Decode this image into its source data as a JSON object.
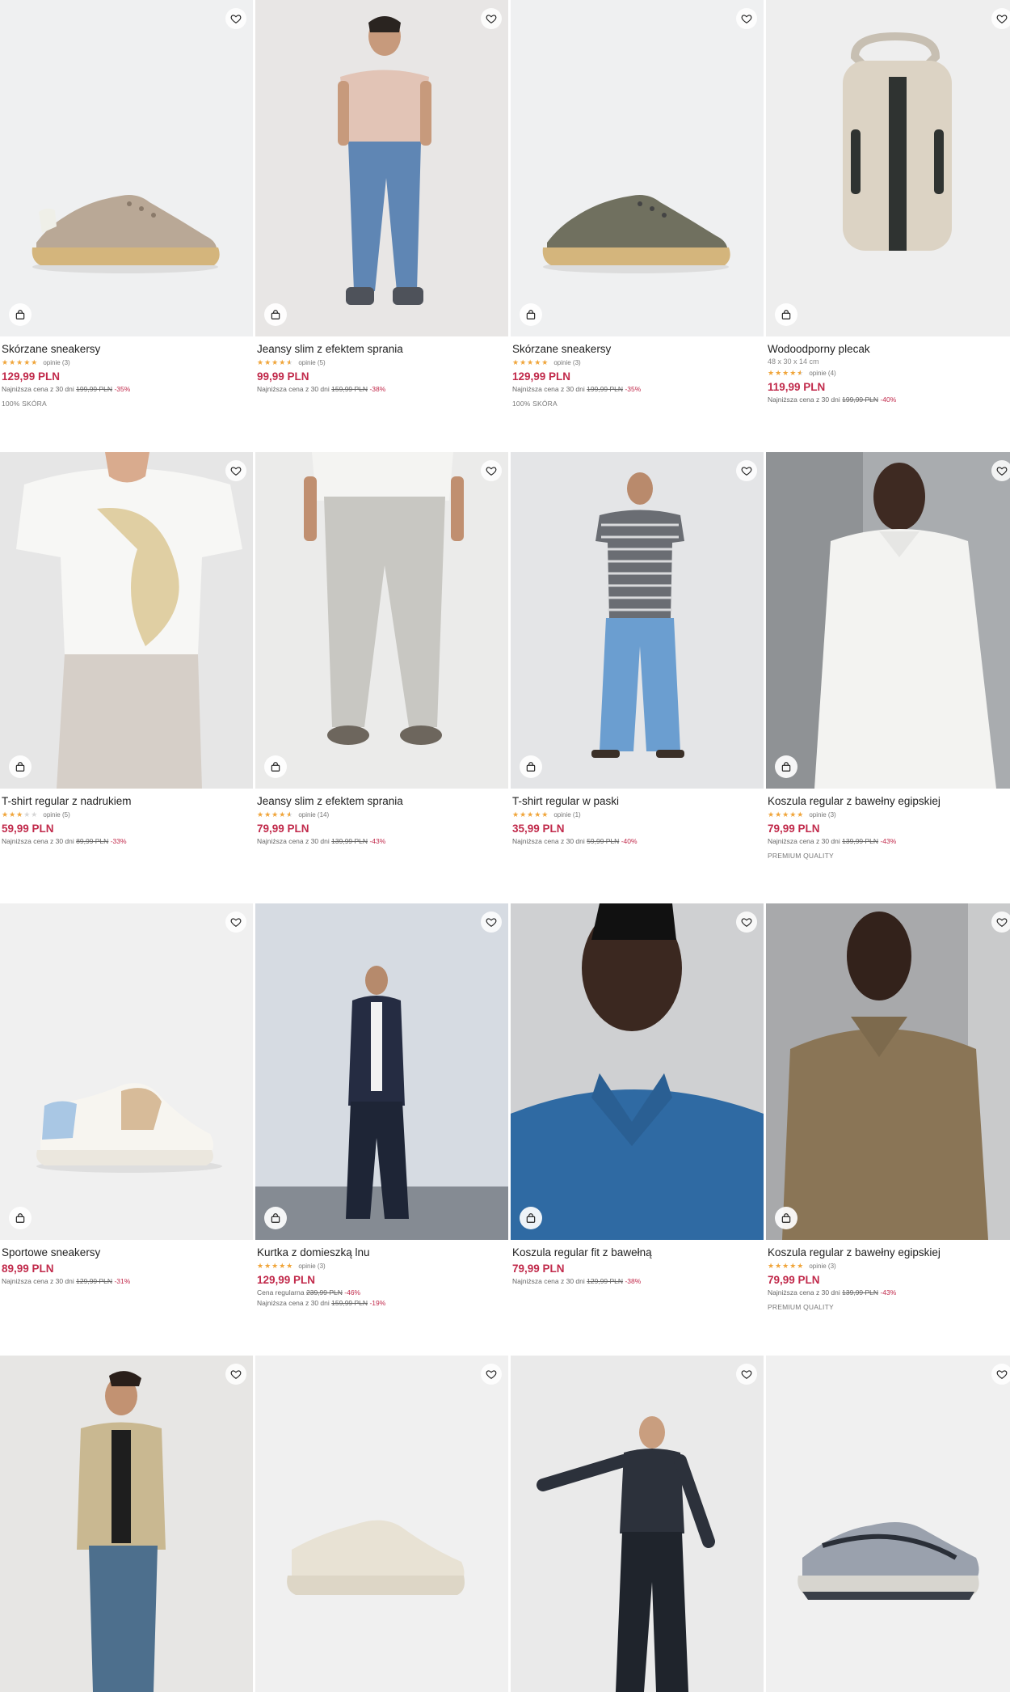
{
  "colors": {
    "price_red": "#c12a4b",
    "star": "#f0a53a"
  },
  "icons": {
    "favorite": "heart-icon",
    "add_to_bag": "shopping-bag-icon"
  },
  "products": [
    {
      "name": "Skórzane sneakersy",
      "reviews": "opinie (3)",
      "rating": 5,
      "price": "129,99 PLN",
      "lowest_label": "Najniższa cena z 30 dni",
      "lowest_old": "199,99 PLN",
      "lowest_pct": "-35%",
      "tag": "100% SKÓRA"
    },
    {
      "name": "Jeansy slim z efektem sprania",
      "reviews": "opinie (5)",
      "rating": 4.5,
      "price": "99,99 PLN",
      "lowest_label": "Najniższa cena z 30 dni",
      "lowest_old": "159,99 PLN",
      "lowest_pct": "-38%"
    },
    {
      "name": "Skórzane sneakersy",
      "reviews": "opinie (3)",
      "rating": 5,
      "price": "129,99 PLN",
      "lowest_label": "Najniższa cena z 30 dni",
      "lowest_old": "199,99 PLN",
      "lowest_pct": "-35%",
      "tag": "100% SKÓRA"
    },
    {
      "name": "Wodoodporny plecak",
      "subtitle": "48 x 30 x 14 cm",
      "reviews": "opinie (4)",
      "rating": 4.5,
      "price": "119,99 PLN",
      "lowest_label": "Najniższa cena z 30 dni",
      "lowest_old": "199,99 PLN",
      "lowest_pct": "-40%"
    },
    {
      "name": "T-shirt regular z nadrukiem",
      "reviews": "opinie (5)",
      "rating": 3,
      "price": "59,99 PLN",
      "lowest_label": "Najniższa cena z 30 dni",
      "lowest_old": "89,99 PLN",
      "lowest_pct": "-33%"
    },
    {
      "name": "Jeansy slim z efektem sprania",
      "reviews": "opinie (14)",
      "rating": 4.5,
      "price": "79,99 PLN",
      "lowest_label": "Najniższa cena z 30 dni",
      "lowest_old": "139,99 PLN",
      "lowest_pct": "-43%"
    },
    {
      "name": "T-shirt regular w paski",
      "reviews": "opinie (1)",
      "rating": 5,
      "price": "35,99 PLN",
      "lowest_label": "Najniższa cena z 30 dni",
      "lowest_old": "59,99 PLN",
      "lowest_pct": "-40%"
    },
    {
      "name": "Koszula regular z bawełny egipskiej",
      "reviews": "opinie (3)",
      "rating": 5,
      "price": "79,99 PLN",
      "lowest_label": "Najniższa cena z 30 dni",
      "lowest_old": "139,99 PLN",
      "lowest_pct": "-43%",
      "tag": "PREMIUM QUALITY"
    },
    {
      "name": "Sportowe sneakersy",
      "price": "89,99 PLN",
      "lowest_label": "Najniższa cena z 30 dni",
      "lowest_old": "129,99 PLN",
      "lowest_pct": "-31%"
    },
    {
      "name": "Kurtka z domieszką lnu",
      "reviews": "opinie (3)",
      "rating": 5,
      "price": "129,99 PLN",
      "regular_label": "Cena regularna",
      "regular_old": "239,99 PLN",
      "regular_pct": "-46%",
      "lowest_label": "Najniższa cena z 30 dni",
      "lowest_old": "159,99 PLN",
      "lowest_pct": "-19%"
    },
    {
      "name": "Koszula regular fit z bawełną",
      "price": "79,99 PLN",
      "lowest_label": "Najniższa cena z 30 dni",
      "lowest_old": "129,99 PLN",
      "lowest_pct": "-38%"
    },
    {
      "name": "Koszula regular z bawełny egipskiej",
      "reviews": "opinie (3)",
      "rating": 5,
      "price": "79,99 PLN",
      "lowest_label": "Najniższa cena z 30 dni",
      "lowest_old": "139,99 PLN",
      "lowest_pct": "-43%",
      "tag": "PREMIUM QUALITY"
    },
    {
      "name": ""
    },
    {
      "name": ""
    },
    {
      "name": ""
    },
    {
      "name": ""
    }
  ]
}
